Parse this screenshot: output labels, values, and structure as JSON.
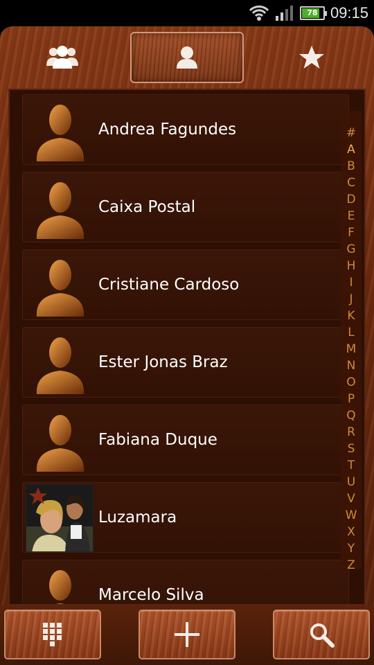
{
  "status_bar": {
    "battery_level": "78",
    "time": "09:15",
    "icons": [
      "wifi-icon",
      "signal-icon",
      "battery-icon"
    ]
  },
  "tabs": [
    {
      "name": "groups",
      "icon": "groups-icon",
      "selected": false
    },
    {
      "name": "people",
      "icon": "person-icon",
      "selected": true
    },
    {
      "name": "favorites",
      "icon": "star-icon",
      "selected": false
    }
  ],
  "contacts": [
    {
      "name": "Andrea Fagundes",
      "avatar": "default-avatar"
    },
    {
      "name": "Caixa Postal",
      "avatar": "default-avatar"
    },
    {
      "name": "Cristiane Cardoso",
      "avatar": "default-avatar"
    },
    {
      "name": "Ester Jonas Braz",
      "avatar": "default-avatar"
    },
    {
      "name": "Fabiana Duque",
      "avatar": "default-avatar"
    },
    {
      "name": "Luzamara",
      "avatar": "photo",
      "favorite": true
    },
    {
      "name": "Marcelo Silva",
      "avatar": "default-avatar"
    }
  ],
  "alpha_index": [
    "#",
    "A",
    "B",
    "C",
    "D",
    "E",
    "F",
    "G",
    "H",
    "I",
    "J",
    "K",
    "L",
    "M",
    "N",
    "O",
    "P",
    "Q",
    "R",
    "S",
    "T",
    "U",
    "V",
    "W",
    "X",
    "Y",
    "Z"
  ],
  "bottom_bar": {
    "buttons": [
      "dialpad-icon",
      "plus-icon",
      "search-icon"
    ]
  },
  "colors": {
    "wood": "#7a3212",
    "panel": "#2e0f04",
    "index_letter": "#d08a3a",
    "text": "#ffffff"
  }
}
